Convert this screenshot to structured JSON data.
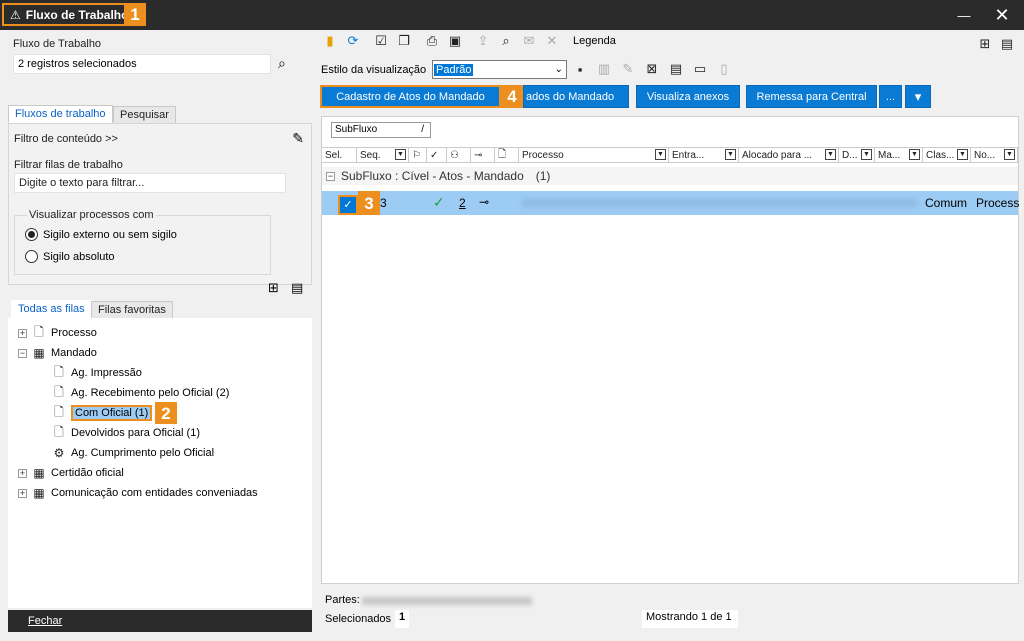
{
  "window": {
    "title": "Fluxo de Trabalho",
    "marker": "1",
    "minimize_glyph": "—",
    "close_glyph": "✕"
  },
  "left": {
    "flow_label": "Fluxo de Trabalho",
    "flow_value": "2 registros selecionados",
    "tabs": [
      "Fluxos de trabalho",
      "Pesquisar"
    ],
    "content_filter": "Filtro de conteúdo >>",
    "filter_label": "Filtrar filas de trabalho",
    "filter_placeholder": "Digite o texto para filtrar...",
    "visualize_label": "Visualizar processos com",
    "radios": [
      {
        "label": "Sigilo externo ou sem sigilo",
        "checked": true
      },
      {
        "label": "Sigilo absoluto",
        "checked": false
      }
    ],
    "queue_tabs": [
      "Todas as filas",
      "Filas favoritas"
    ],
    "tree": [
      {
        "label": "Processo",
        "level": 0,
        "exp": "+",
        "icon": "doc-icon"
      },
      {
        "label": "Mandado",
        "level": 0,
        "exp": "−",
        "icon": "docs-icon"
      },
      {
        "label": "Ag. Impressão",
        "level": 1,
        "icon": "doc-icon"
      },
      {
        "label": "Ag. Recebimento pelo Oficial (2)",
        "level": 1,
        "icon": "doc-icon"
      },
      {
        "label": "Com Oficial (1)",
        "level": 1,
        "icon": "doc-icon",
        "selected": true,
        "marker": "2"
      },
      {
        "label": "Devolvidos para Oficial (1)",
        "level": 1,
        "icon": "doc-icon"
      },
      {
        "label": "Ag. Cumprimento pelo Oficial",
        "level": 1,
        "icon": "gear-doc-icon"
      },
      {
        "label": "Certidão oficial",
        "level": 0,
        "exp": "+",
        "icon": "docs-icon"
      },
      {
        "label": "Comunicação com entidades conveniadas",
        "level": 0,
        "exp": "+",
        "icon": "docs-icon"
      }
    ],
    "close_button": "Fechar"
  },
  "toolbar": {
    "legend": "Legenda",
    "view_style_label": "Estilo da visualização",
    "view_style_value": "Padrão"
  },
  "actions": [
    {
      "label": "Cadastro de Atos do Mandado",
      "marker": "4"
    },
    {
      "label": "ados do Mandado"
    },
    {
      "label": "Visualiza anexos"
    },
    {
      "label": "Remessa para Central"
    },
    {
      "label": "..."
    },
    {
      "label": "▾"
    }
  ],
  "grid": {
    "group_by": "SubFluxo",
    "group_by_glyph": "/",
    "columns": [
      "Sel.",
      "Seq.",
      "",
      "",
      "",
      "",
      "Processo",
      "Entra...",
      "Alocado para ...",
      "D...",
      "Ma...",
      "Clas...",
      "No..."
    ],
    "group_label": "SubFluxo : Cível - Atos - Mandado",
    "group_count": "(1)",
    "row": {
      "marker": "3",
      "seq": "3",
      "count": "2",
      "class": "Comum",
      "name": "Process"
    }
  },
  "status": {
    "parts_label": "Partes:",
    "selected_label": "Selecionados",
    "selected_value": "1",
    "showing": "Mostrando 1 de 1"
  },
  "colors": {
    "accent_orange": "#ec8f1e",
    "button_blue": "#0a7bd4",
    "selection_blue": "#9ccbf3",
    "titlebar": "#2b2b2b"
  }
}
